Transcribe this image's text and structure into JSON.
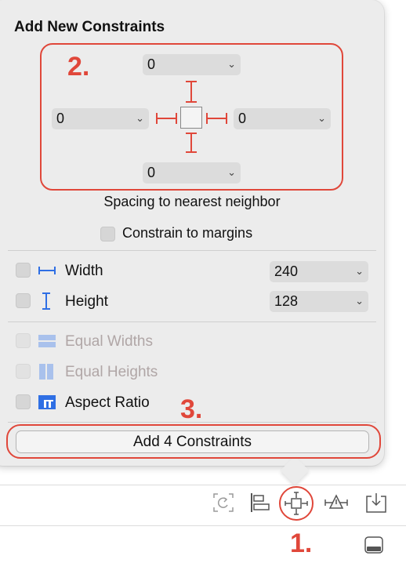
{
  "popover": {
    "title": "Add New Constraints",
    "spacing": {
      "top": "0",
      "left": "0",
      "right": "0",
      "bottom": "0",
      "caption": "Spacing to nearest neighbor"
    },
    "constrain_to_margins": "Constrain to margins",
    "width": {
      "label": "Width",
      "value": "240"
    },
    "height": {
      "label": "Height",
      "value": "128"
    },
    "equal_widths": "Equal Widths",
    "equal_heights": "Equal Heights",
    "aspect_ratio": "Aspect Ratio",
    "add_button": "Add 4 Constraints"
  },
  "annotations": {
    "step1": "1.",
    "step2": "2.",
    "step3": "3."
  },
  "colors": {
    "annotation_red": "#e0473a",
    "icon_blue": "#2f6fe4",
    "popover_bg": "#ececec"
  },
  "toolbar_icons": [
    "update-frames-icon",
    "align-icon",
    "add-constraints-icon",
    "resolve-issues-icon",
    "embed-in-icon"
  ],
  "bottom_icon": "device-icon"
}
